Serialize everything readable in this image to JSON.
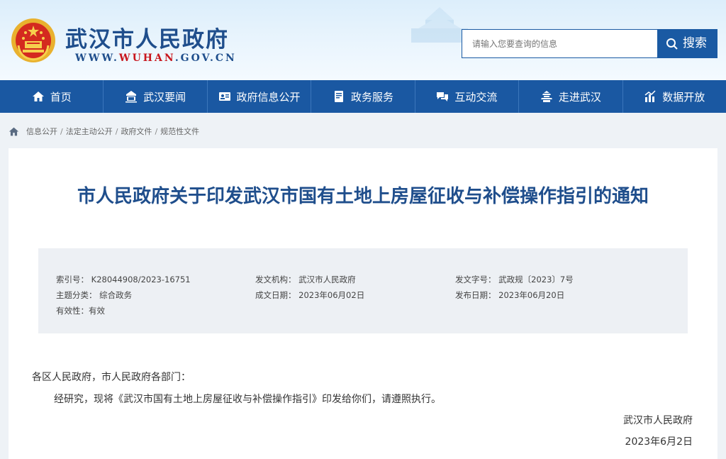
{
  "header": {
    "site_title": "武汉市人民政府",
    "site_url_prefix": "WWW.",
    "site_url_accent": "WUHAN",
    "site_url_suffix": ".GOV.CN",
    "search_placeholder": "请输入您要查询的信息",
    "search_button": "搜索",
    "brand_blue": "#1a58a2",
    "accent_red": "#c8161d"
  },
  "nav": {
    "items": [
      {
        "label": "首页",
        "icon": "home-icon"
      },
      {
        "label": "武汉要闻",
        "icon": "building-icon"
      },
      {
        "label": "政府信息公开",
        "icon": "id-card-icon"
      },
      {
        "label": "政务服务",
        "icon": "document-icon"
      },
      {
        "label": "互动交流",
        "icon": "chat-icon"
      },
      {
        "label": "走进武汉",
        "icon": "pagoda-icon"
      },
      {
        "label": "数据开放",
        "icon": "bar-chart-icon"
      }
    ]
  },
  "breadcrumb": [
    "信息公开",
    "法定主动公开",
    "政府文件",
    "规范性文件"
  ],
  "document": {
    "title": "市人民政府关于印发武汉市国有土地上房屋征收与补偿操作指引的通知",
    "meta": {
      "index_no": "索引号：  K28044908/2023-16751",
      "issuer": "发文机构：  武汉市人民政府",
      "doc_no": "发文字号：  武政规〔2023〕7号",
      "category": "主题分类：  综合政务",
      "created": "成文日期：  2023年06月02日",
      "published": "发布日期：  2023年06月20日",
      "validity": "有效性：有效"
    },
    "salutation": "各区人民政府，市人民政府各部门：",
    "paragraph": "经研究，现将《武汉市国有土地上房屋征收与补偿操作指引》印发给你们，请遵照执行。",
    "signature": "武汉市人民政府",
    "date": "2023年6月2日"
  }
}
